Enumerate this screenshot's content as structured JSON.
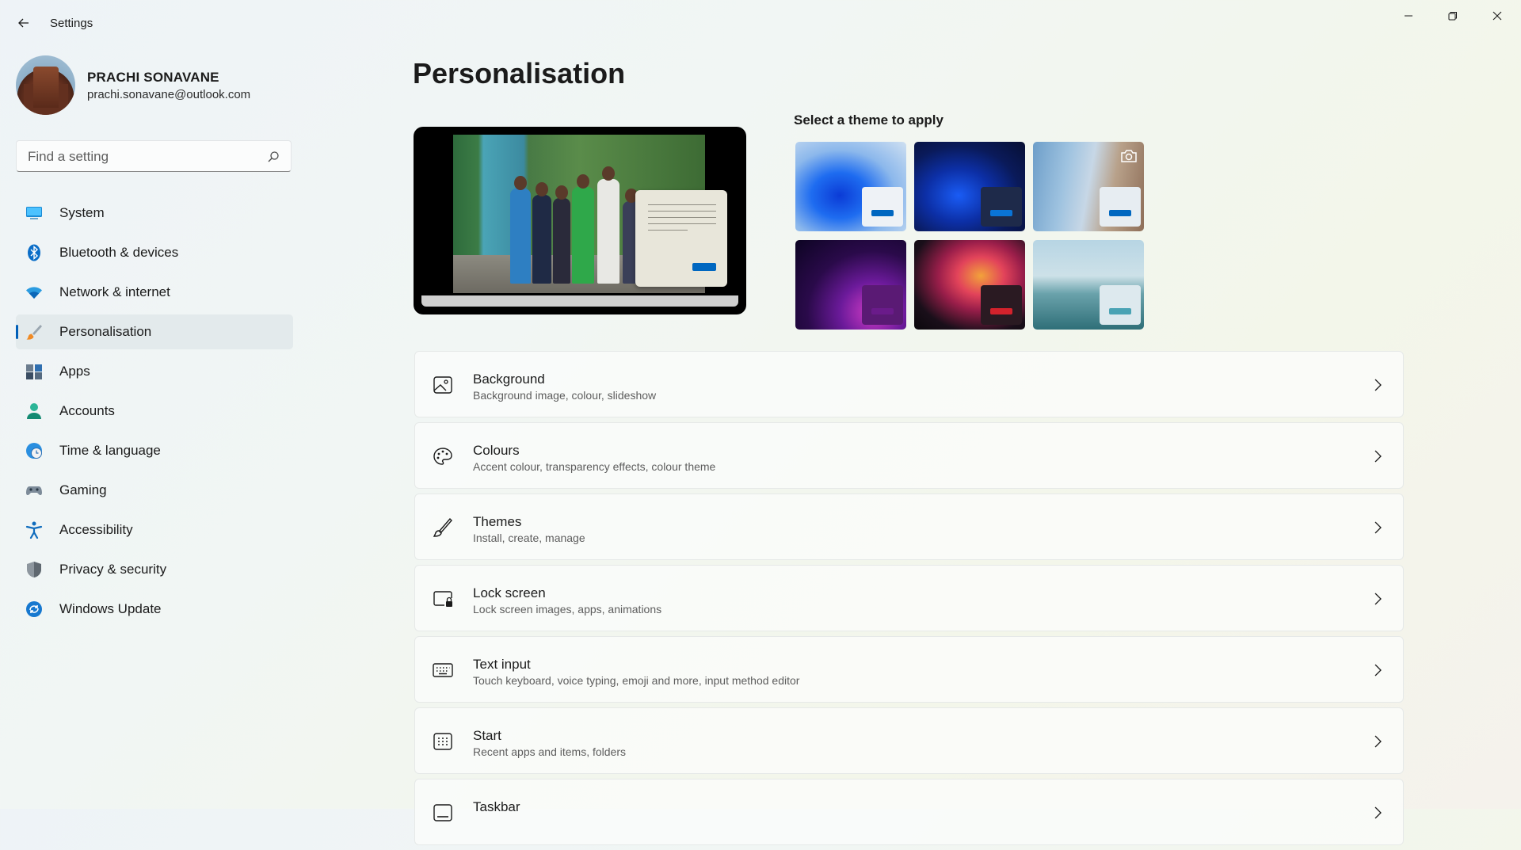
{
  "window": {
    "title": "Settings"
  },
  "profile": {
    "name": "PRACHI SONAVANE",
    "email": "prachi.sonavane@outlook.com"
  },
  "search": {
    "placeholder": "Find a setting"
  },
  "sidebar": {
    "items": [
      {
        "label": "System",
        "icon": "system-icon",
        "color": "#0078d4"
      },
      {
        "label": "Bluetooth & devices",
        "icon": "bluetooth-icon",
        "color": "#0078d4"
      },
      {
        "label": "Network & internet",
        "icon": "wifi-icon",
        "color": "#0078d4"
      },
      {
        "label": "Personalisation",
        "icon": "paintbrush-icon",
        "color": "#e67e22",
        "active": true
      },
      {
        "label": "Apps",
        "icon": "apps-icon",
        "color": "#445a72"
      },
      {
        "label": "Accounts",
        "icon": "accounts-icon",
        "color": "#1aa38a"
      },
      {
        "label": "Time & language",
        "icon": "globe-clock-icon",
        "color": "#1f86d6"
      },
      {
        "label": "Gaming",
        "icon": "gamepad-icon",
        "color": "#6b7b8a"
      },
      {
        "label": "Accessibility",
        "icon": "accessibility-icon",
        "color": "#0f6cbd"
      },
      {
        "label": "Privacy & security",
        "icon": "shield-icon",
        "color": "#6b7580"
      },
      {
        "label": "Windows Update",
        "icon": "update-icon",
        "color": "#0f6cbd"
      }
    ]
  },
  "main": {
    "title": "Personalisation",
    "theme_heading": "Select a theme to apply",
    "themes": [
      {
        "name": "windows-light",
        "accent": "#0067c0"
      },
      {
        "name": "windows-dark",
        "accent": "#0067c0"
      },
      {
        "name": "glow-blossom",
        "accent": "#0067c0"
      },
      {
        "name": "captured-motion",
        "accent": "#6a1b8a"
      },
      {
        "name": "flow",
        "accent": "#d3222c"
      },
      {
        "name": "sunrise-lake",
        "accent": "#4aa3b4"
      }
    ],
    "settings": [
      {
        "title": "Background",
        "subtitle": "Background image, colour, slideshow",
        "icon": "image-icon"
      },
      {
        "title": "Colours",
        "subtitle": "Accent colour, transparency effects, colour theme",
        "icon": "palette-icon"
      },
      {
        "title": "Themes",
        "subtitle": "Install, create, manage",
        "icon": "brush-icon"
      },
      {
        "title": "Lock screen",
        "subtitle": "Lock screen images, apps, animations",
        "icon": "lock-screen-icon"
      },
      {
        "title": "Text input",
        "subtitle": "Touch keyboard, voice typing, emoji and more, input method editor",
        "icon": "keyboard-icon"
      },
      {
        "title": "Start",
        "subtitle": "Recent apps and items, folders",
        "icon": "start-icon"
      },
      {
        "title": "Taskbar",
        "subtitle": "",
        "icon": "taskbar-icon"
      }
    ]
  }
}
